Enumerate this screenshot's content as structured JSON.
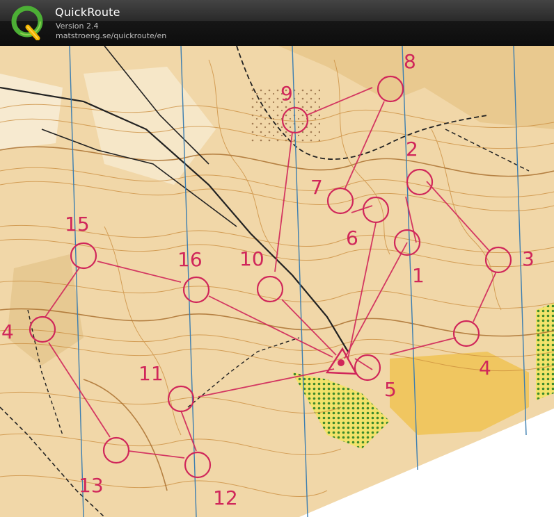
{
  "app": {
    "title": "QuickRoute",
    "version": "Version 2.4",
    "url": "matstroeng.se/quickroute/en",
    "logo_letter": "Q"
  },
  "map": {
    "course_color": "#d0265a",
    "start_label": "",
    "controls": [
      {
        "label": "1"
      },
      {
        "label": "2"
      },
      {
        "label": "3"
      },
      {
        "label": "4"
      },
      {
        "label": "5"
      },
      {
        "label": "6"
      },
      {
        "label": "7"
      },
      {
        "label": "8"
      },
      {
        "label": "9"
      },
      {
        "label": "10"
      },
      {
        "label": "11"
      },
      {
        "label": "12"
      },
      {
        "label": "13"
      },
      {
        "label": "4"
      },
      {
        "label": "15"
      },
      {
        "label": "16"
      }
    ]
  }
}
